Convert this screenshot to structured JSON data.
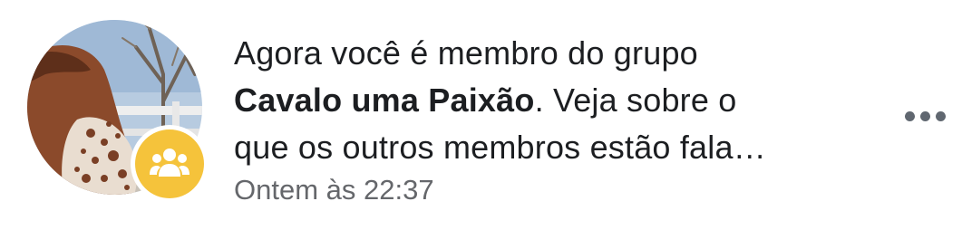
{
  "notification": {
    "line1": "Agora você é membro do grupo",
    "group_name": "Cavalo uma Paixão",
    "line2_rest": ". Veja sobre o",
    "line3": "que os outros membros estão fala…",
    "timestamp": "Ontem às 22:37",
    "badge_icon": "group-icon",
    "badge_color": "#f5c33b",
    "more_icon": "more-options-icon"
  }
}
